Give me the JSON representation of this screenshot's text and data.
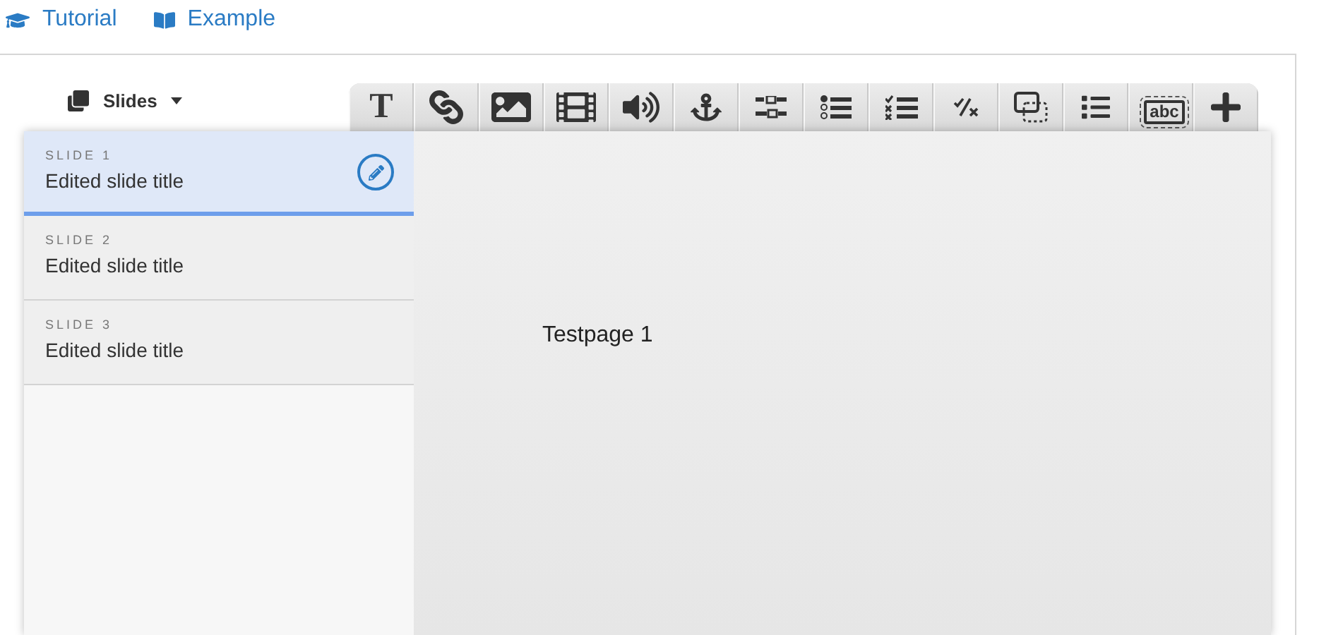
{
  "top_links": [
    {
      "kind": "tutorial",
      "label": "Tutorial"
    },
    {
      "kind": "example",
      "label": "Example"
    }
  ],
  "slides_menu": {
    "label": "Slides"
  },
  "toolbar": [
    {
      "kind": "text",
      "glyph": "T"
    },
    {
      "kind": "link"
    },
    {
      "kind": "image"
    },
    {
      "kind": "video"
    },
    {
      "kind": "audio"
    },
    {
      "kind": "anchor"
    },
    {
      "kind": "options"
    },
    {
      "kind": "radio-list"
    },
    {
      "kind": "check-list"
    },
    {
      "kind": "true-false"
    },
    {
      "kind": "overlay"
    },
    {
      "kind": "list"
    },
    {
      "kind": "textfield",
      "glyph": "abc"
    },
    {
      "kind": "add"
    }
  ],
  "slides": [
    {
      "number": "SLIDE 1",
      "title": "Edited slide title",
      "selected": true
    },
    {
      "number": "SLIDE 2",
      "title": "Edited slide title",
      "selected": false
    },
    {
      "number": "SLIDE 3",
      "title": "Edited slide title",
      "selected": false
    }
  ],
  "canvas": {
    "text": "Testpage 1"
  }
}
